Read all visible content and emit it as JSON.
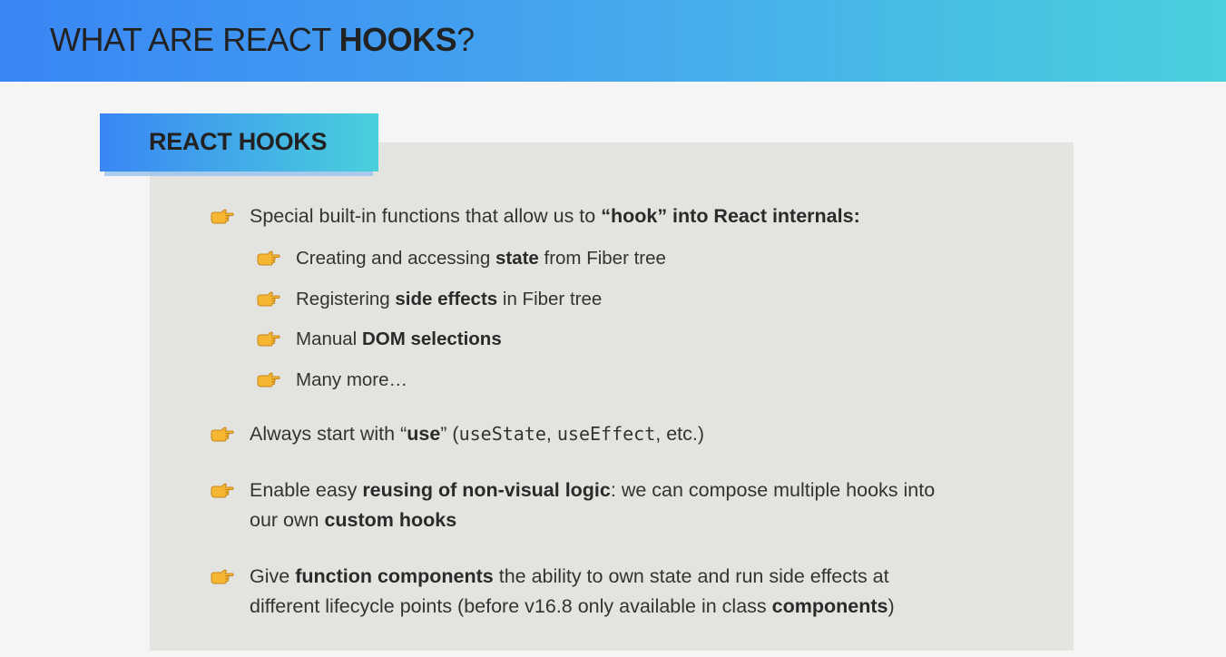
{
  "header": {
    "title_prefix": "WHAT ARE REACT ",
    "title_bold": "HOOKS",
    "title_suffix": "?"
  },
  "badge": {
    "label": "REACT HOOKS"
  },
  "colors": {
    "gradient_start": "#3a86f5",
    "gradient_end": "#4ad0dc",
    "panel": "#e3e3df",
    "background": "#f5f5f5",
    "hand_icon": "#f5b731"
  },
  "icons": {
    "bullet": "pointing-hand-icon"
  },
  "bullets": {
    "b1": {
      "t1": "Special built-in functions that allow us to ",
      "b1": "“hook” into React internals:"
    },
    "sub": {
      "s1": {
        "t1": "Creating and accessing ",
        "b1": "state",
        "t2": " from Fiber tree"
      },
      "s2": {
        "t1": "Registering ",
        "b1": "side effects",
        "t2": " in Fiber tree"
      },
      "s3": {
        "t1": "Manual ",
        "b1": "DOM selections"
      },
      "s4": {
        "t1": "Many more…"
      }
    },
    "b2": {
      "t1": "Always start with “",
      "b1": "use",
      "t2": "” (",
      "c1": "useState",
      "t3": ", ",
      "c2": "useEffect",
      "t4": ", etc.)"
    },
    "b3": {
      "t1": "Enable easy ",
      "b1": "reusing of non-visual logic",
      "t2": ": we can compose multiple hooks into",
      "t3": "our own ",
      "b2": "custom hooks"
    },
    "b4": {
      "t1": "Give ",
      "b1": "function components",
      "t2": " the ability to own state and run side effects at",
      "t3": "different lifecycle points (before v16.8 only available in class ",
      "b2": "components",
      "t4": ")"
    }
  }
}
